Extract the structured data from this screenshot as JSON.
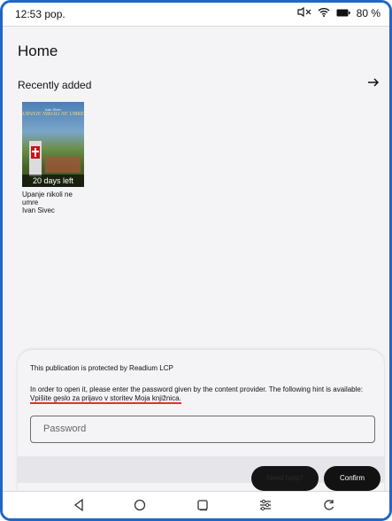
{
  "status_bar": {
    "time": "12:53 pop.",
    "battery_percent": "80 %",
    "icons": [
      "mute-icon",
      "wifi-icon",
      "battery-icon"
    ]
  },
  "header": {
    "title": "Home"
  },
  "section": {
    "title": "Recently added",
    "arrow_icon": "arrow-right-icon"
  },
  "book": {
    "cover_author": "Ivan Sivec",
    "cover_title": "UPANJE NIKOLI NE UMRE",
    "badge": "20 days left",
    "title": "Upanje nikoli ne umre",
    "author": "Ivan Sivec"
  },
  "dialog": {
    "heading": "This publication is protected by Readium LCP",
    "body_prefix": "In order to open it, please enter the password given by the content provider. The following hint is available: ",
    "hint": "Vpišite geslo za prijavo v storitev Moja knjižnica.",
    "password_placeholder": "Password",
    "password_value": "",
    "left_button_label": "Need help?",
    "confirm_label": "Confirm"
  },
  "nav_bar": {
    "icons": [
      "back-icon",
      "home-icon",
      "recents-icon",
      "settings-adjust-icon",
      "rotate-icon"
    ]
  }
}
